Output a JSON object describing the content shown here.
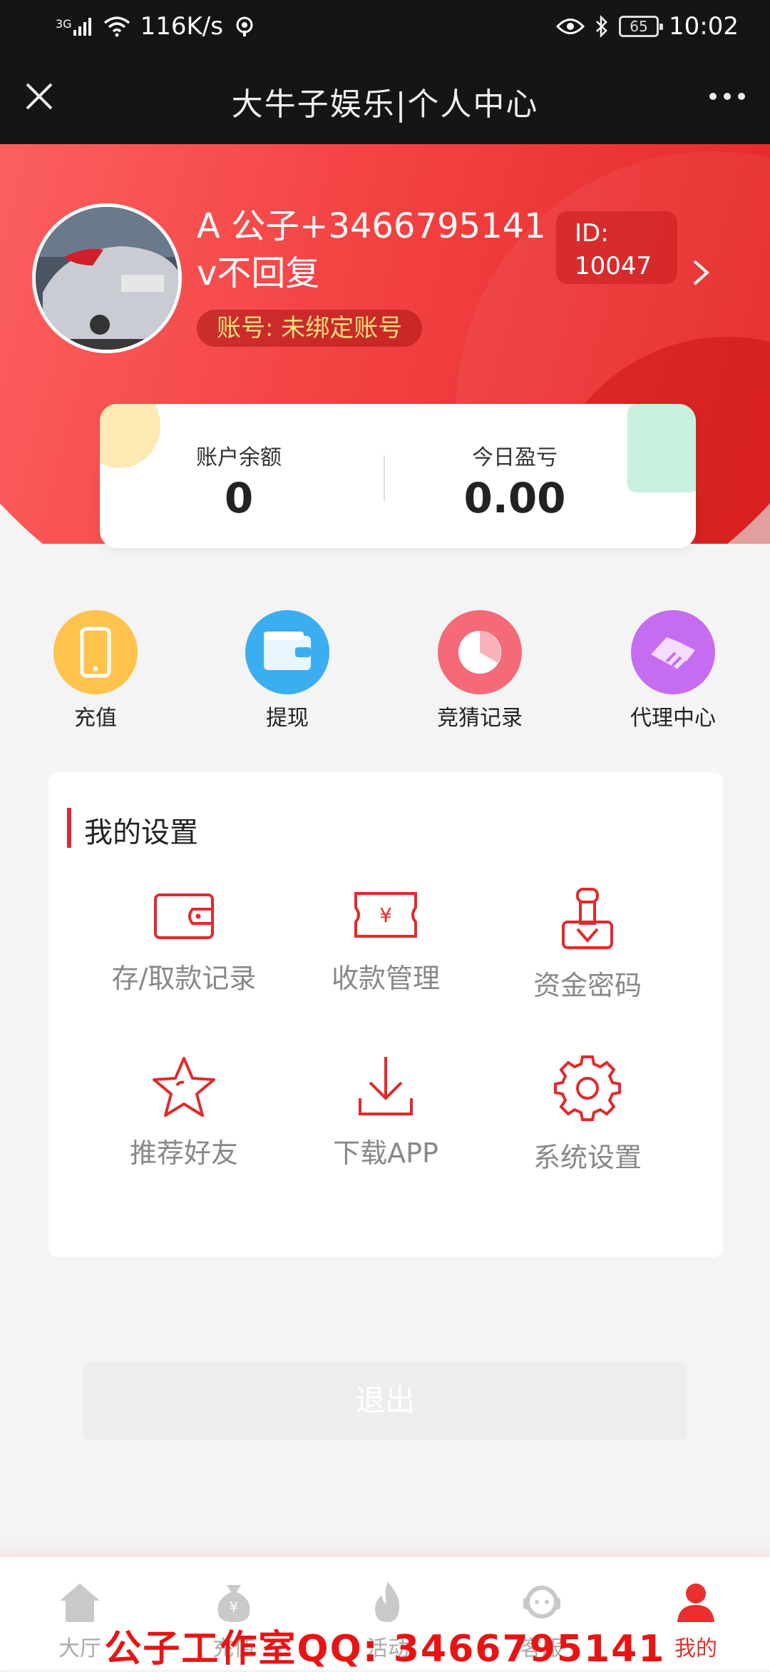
{
  "status_bar": {
    "network": "3G",
    "speed": "116K/s",
    "battery": "65",
    "time": "10:02"
  },
  "title_bar": {
    "title": "大牛子娱乐|个人中心"
  },
  "profile": {
    "name_line1": "A 公子+3466795141",
    "name_line2": "v不回复",
    "account_status": "账号: 未绑定账号",
    "id_label": "ID:",
    "id_value": "10047"
  },
  "balance": {
    "balance_label": "账户余额",
    "balance_value": "0",
    "profit_label": "今日盈亏",
    "profit_value": "0.00"
  },
  "quick_actions": [
    {
      "label": "充值",
      "icon": "phone-icon",
      "color": "#ffc24d"
    },
    {
      "label": "提现",
      "icon": "wallet-icon",
      "color": "#3aaef0"
    },
    {
      "label": "竞猜记录",
      "icon": "pie-chart-icon",
      "color": "#f46a78"
    },
    {
      "label": "代理中心",
      "icon": "handshake-icon",
      "color": "#c56cf0"
    }
  ],
  "settings": {
    "title": "我的设置",
    "items": [
      {
        "label": "存/取款记录",
        "icon": "wallet-icon"
      },
      {
        "label": "收款管理",
        "icon": "ticket-yen-icon"
      },
      {
        "label": "资金密码",
        "icon": "lock-icon"
      },
      {
        "label": "推荐好友",
        "icon": "star-icon"
      },
      {
        "label": "下载APP",
        "icon": "download-icon"
      },
      {
        "label": "系统设置",
        "icon": "gear-icon"
      }
    ]
  },
  "logout_label": "退出",
  "tabs": [
    {
      "label": "大厅",
      "icon": "home-icon"
    },
    {
      "label": "充值",
      "icon": "money-bag-icon"
    },
    {
      "label": "活动",
      "icon": "flame-icon"
    },
    {
      "label": "客服",
      "icon": "headset-icon"
    },
    {
      "label": "我的",
      "icon": "user-icon",
      "active": true
    }
  ],
  "watermark": "公子工作室QQ: 3466795141",
  "accent_color": "#e02a2a"
}
